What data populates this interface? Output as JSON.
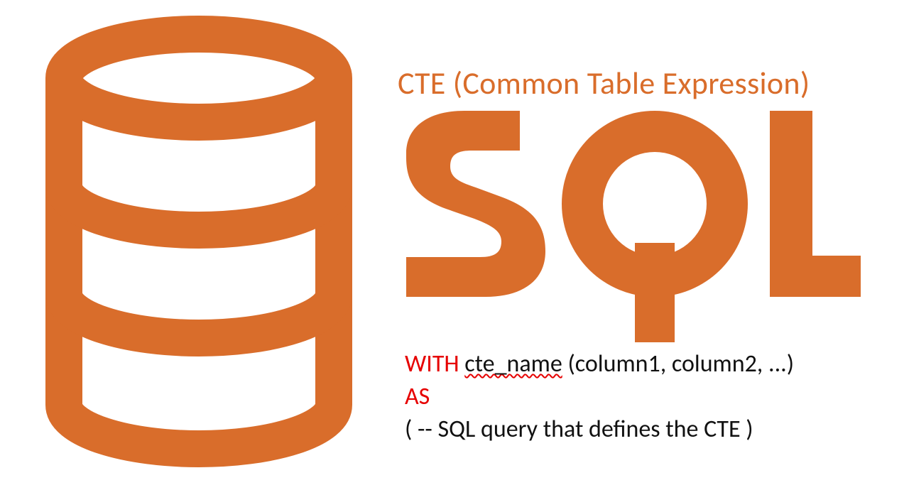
{
  "colors": {
    "orange": "#d96d2b",
    "red": "#e60000",
    "black": "#111111"
  },
  "title": "CTE (Common Table Expression)",
  "sql_logo_text": "SQL",
  "code": {
    "line1": {
      "keyword": "WITH",
      "cte_name": "cte_name",
      "columns": " (column1, column2, ...)"
    },
    "line2": {
      "keyword": "AS"
    },
    "line3": "(  -- SQL query that defines the CTE  )"
  },
  "icons": {
    "database": "database-icon",
    "sql_logo": "sql-logo"
  }
}
